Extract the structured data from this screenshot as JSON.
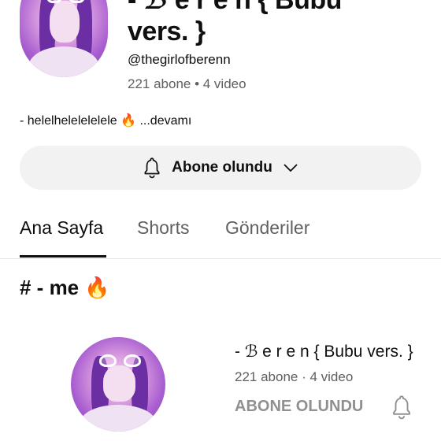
{
  "channel": {
    "title_line1": "- ℬ e r e n { Bubu",
    "title_line2": "vers. }",
    "handle": "@thegirlofberenn",
    "meta": "221 abone • 4 video",
    "description": "- helelhelelelelele 🔥 ...devamı"
  },
  "subscribe_button": {
    "label": "Abone olundu",
    "icon": "bell-icon"
  },
  "tabs": [
    {
      "label": "Ana Sayfa",
      "active": true
    },
    {
      "label": "Shorts",
      "active": false
    },
    {
      "label": "Gönderiler",
      "active": false
    }
  ],
  "section": {
    "title": "# - me 🔥"
  },
  "featured_channel": {
    "name": "- ℬ e r e n { Bubu vers. }",
    "meta": "221 abone · 4 video",
    "button_label": "ABONE OLUNDU",
    "icon": "bell-icon"
  },
  "colors": {
    "secondary_text": "#606060",
    "button_bg": "#f2f2f2",
    "muted_button": "#909090"
  }
}
